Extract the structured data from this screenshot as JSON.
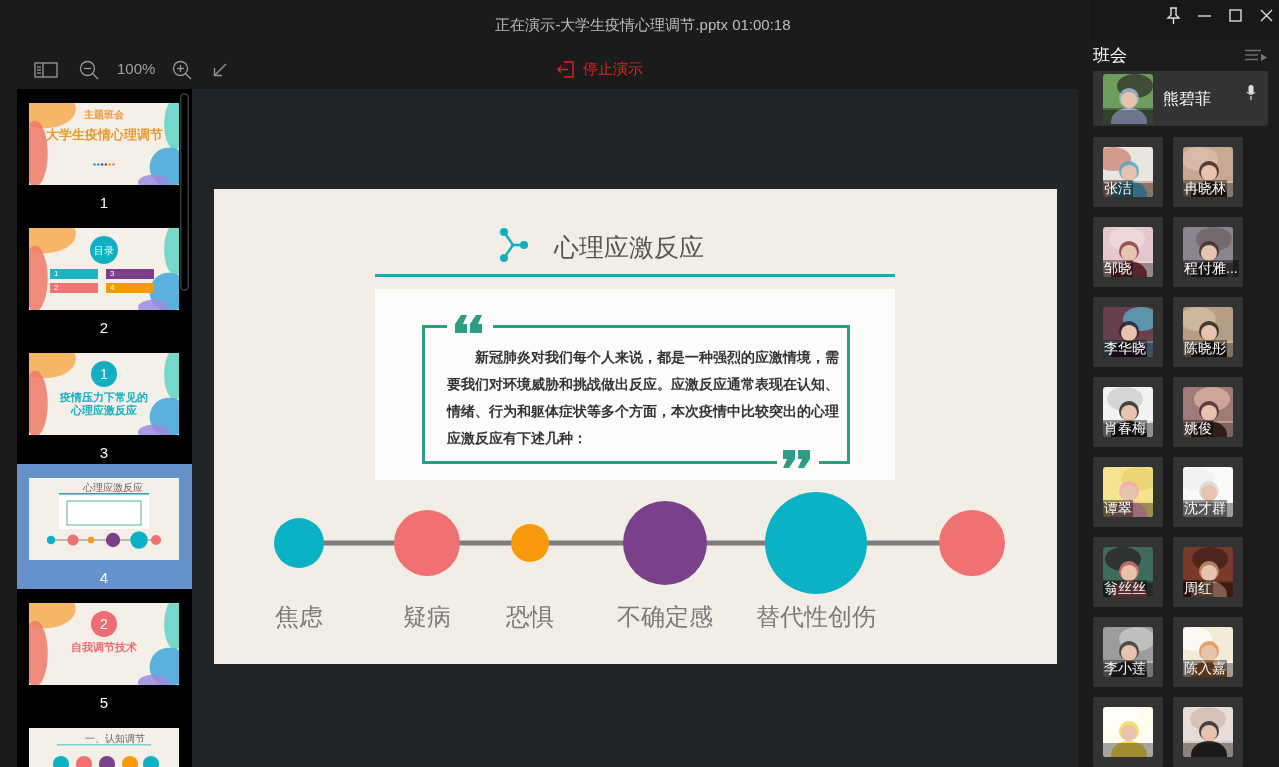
{
  "window": {
    "title": "正在演示-大学生疫情心理调节.pptx 01:00:18"
  },
  "toolbar": {
    "zoom": "100%",
    "stop_button": "停止演示"
  },
  "slides": [
    {
      "number": "1",
      "selected": false,
      "kind": "cover",
      "badge": "主题班会",
      "title": "大学生疫情心理调节"
    },
    {
      "number": "2",
      "selected": false,
      "kind": "toc",
      "title": "目录",
      "items": [
        {
          "number": "1",
          "color": "#1fb3c4"
        },
        {
          "number": "3",
          "color": "#7b3f8c"
        },
        {
          "number": "2",
          "color": "#f07575"
        },
        {
          "number": "4",
          "color": "#f99a0c"
        }
      ]
    },
    {
      "number": "3",
      "selected": false,
      "kind": "section",
      "badge": "1",
      "color": "#12afc2",
      "title": "疫情压力下常见的心理应激反应"
    },
    {
      "number": "4",
      "selected": true,
      "kind": "content",
      "title": "心理应激反应"
    },
    {
      "number": "5",
      "selected": false,
      "kind": "section",
      "badge": "2",
      "color": "#ee6c73",
      "title": "自我调节技术"
    },
    {
      "selected": false,
      "kind": "subsection",
      "title": "一、认知调节"
    }
  ],
  "current_slide": {
    "title": "心理应激反应",
    "quote": "新冠肺炎对我们每个人来说，都是一种强烈的应激情境，需要我们对环境威胁和挑战做出反应。应激反应通常表现在认知、情绪、行为和躯体症状等多个方面，本次疫情中比较突出的心理应激反应有下述几种：",
    "reactions": [
      {
        "label": "焦虑",
        "color": "#0bb1c5"
      },
      {
        "label": "疑病",
        "color": "#ef7172"
      },
      {
        "label": "恐惧",
        "color": "#f99a0c"
      },
      {
        "label": "不确定感",
        "color": "#7a418a"
      },
      {
        "label": "替代性创伤",
        "color": "#0bb1c5"
      },
      {
        "color": "#ef7172"
      }
    ]
  },
  "meeting": {
    "title": "班会",
    "presenter": {
      "name": "熊碧菲",
      "kind": "picture"
    },
    "participants": [
      {
        "name": "张洁",
        "kind": "picture"
      },
      {
        "name": "冉晓林",
        "kind": "picture"
      },
      {
        "name": "邹晓",
        "kind": "picture"
      },
      {
        "name": "程付雅...",
        "kind": "picture"
      },
      {
        "name": "李华晓",
        "kind": "picture"
      },
      {
        "name": "陈晓彤",
        "kind": "picture"
      },
      {
        "name": "肖春梅",
        "kind": "picture"
      },
      {
        "name": "姚俊",
        "kind": "picture"
      },
      {
        "name": "谭翠",
        "kind": "picture"
      },
      {
        "name": "沈才群",
        "kind": "picture"
      },
      {
        "name": "翁丝丝",
        "kind": "picture"
      },
      {
        "name": "周红",
        "kind": "picture"
      },
      {
        "name": "李小莲",
        "kind": "picture"
      },
      {
        "name": "陈入嘉",
        "kind": "picture"
      },
      {
        "kind": "picture"
      },
      {
        "kind": "picture"
      }
    ]
  }
}
